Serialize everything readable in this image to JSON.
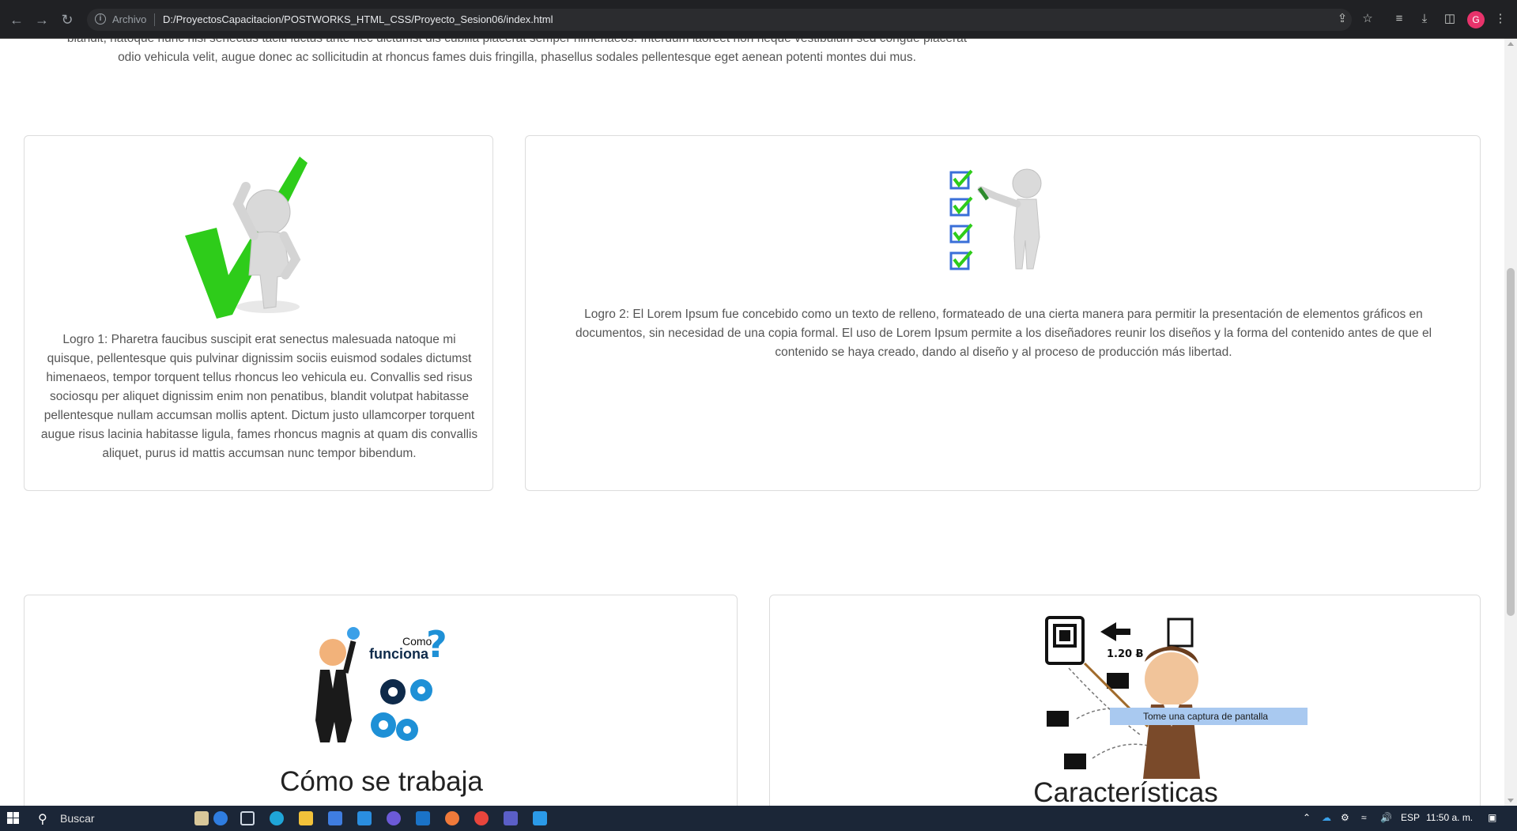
{
  "browser": {
    "scheme_label": "Archivo",
    "url": "D:/ProyectosCapacitacion/POSTWORKS_HTML_CSS/Proyecto_Sesion06/index.html",
    "avatar_letter": "G"
  },
  "intro": {
    "line1": "blandit, natoque nunc nisi senectus taciti luctus ante nec dictumst dis cubilia placerat semper himenaeos. Interdum laoreet non neque vestibulum sed congue placerat",
    "line2": "odio vehicula velit, augue donec ac sollicitudin at rhoncus fames duis fringilla, phasellus sodales pellentesque eget aenean potenti montes dui mus."
  },
  "logros": [
    {
      "image": "figure-with-checkmark",
      "text": "Logro 1: Pharetra faucibus suscipit erat senectus malesuada natoque mi quisque, pellentesque quis pulvinar dignissim sociis euismod sodales dictumst himenaeos, tempor torquent tellus rhoncus leo vehicula eu. Convallis sed risus sociosqu per aliquet dignissim enim non penatibus, blandit volutpat habitasse pellentesque nullam accumsan mollis aptent. Dictum justo ullamcorper torquent augue risus lacinia habitasse ligula, fames rhoncus magnis at quam dis convallis aliquet, purus id mattis accumsan nunc tempor bibendum."
    },
    {
      "image": "figure-with-checklist",
      "text": "Logro 2: El Lorem Ipsum fue concebido como un texto de relleno, formateado de una cierta manera para permitir la presentación de elementos gráficos en documentos, sin necesidad de una copia formal. El uso de Lorem Ipsum permite a los diseñadores reunir los diseños y la forma del contenido antes de que el contenido se haya creado, dando al diseño y al proceso de producción más libertad."
    }
  ],
  "features": [
    {
      "image": "como-funciona-gears",
      "image_text_small": "Como",
      "image_text_big": "funciona",
      "title": "Cómo se trabaja"
    },
    {
      "image": "presenter-network-diagram",
      "image_price": "1.20 Ƀ",
      "title": "Características"
    }
  ],
  "tooltip": "Tome una captura de pantalla",
  "taskbar": {
    "search_label": "Buscar",
    "language": "ESP",
    "time": "11:50 a. m."
  },
  "colors": {
    "chrome_bg": "#202124",
    "check_green": "#2ecc1a",
    "gear_blue": "#1e90d6",
    "taskbar_bg": "#1b2637"
  }
}
